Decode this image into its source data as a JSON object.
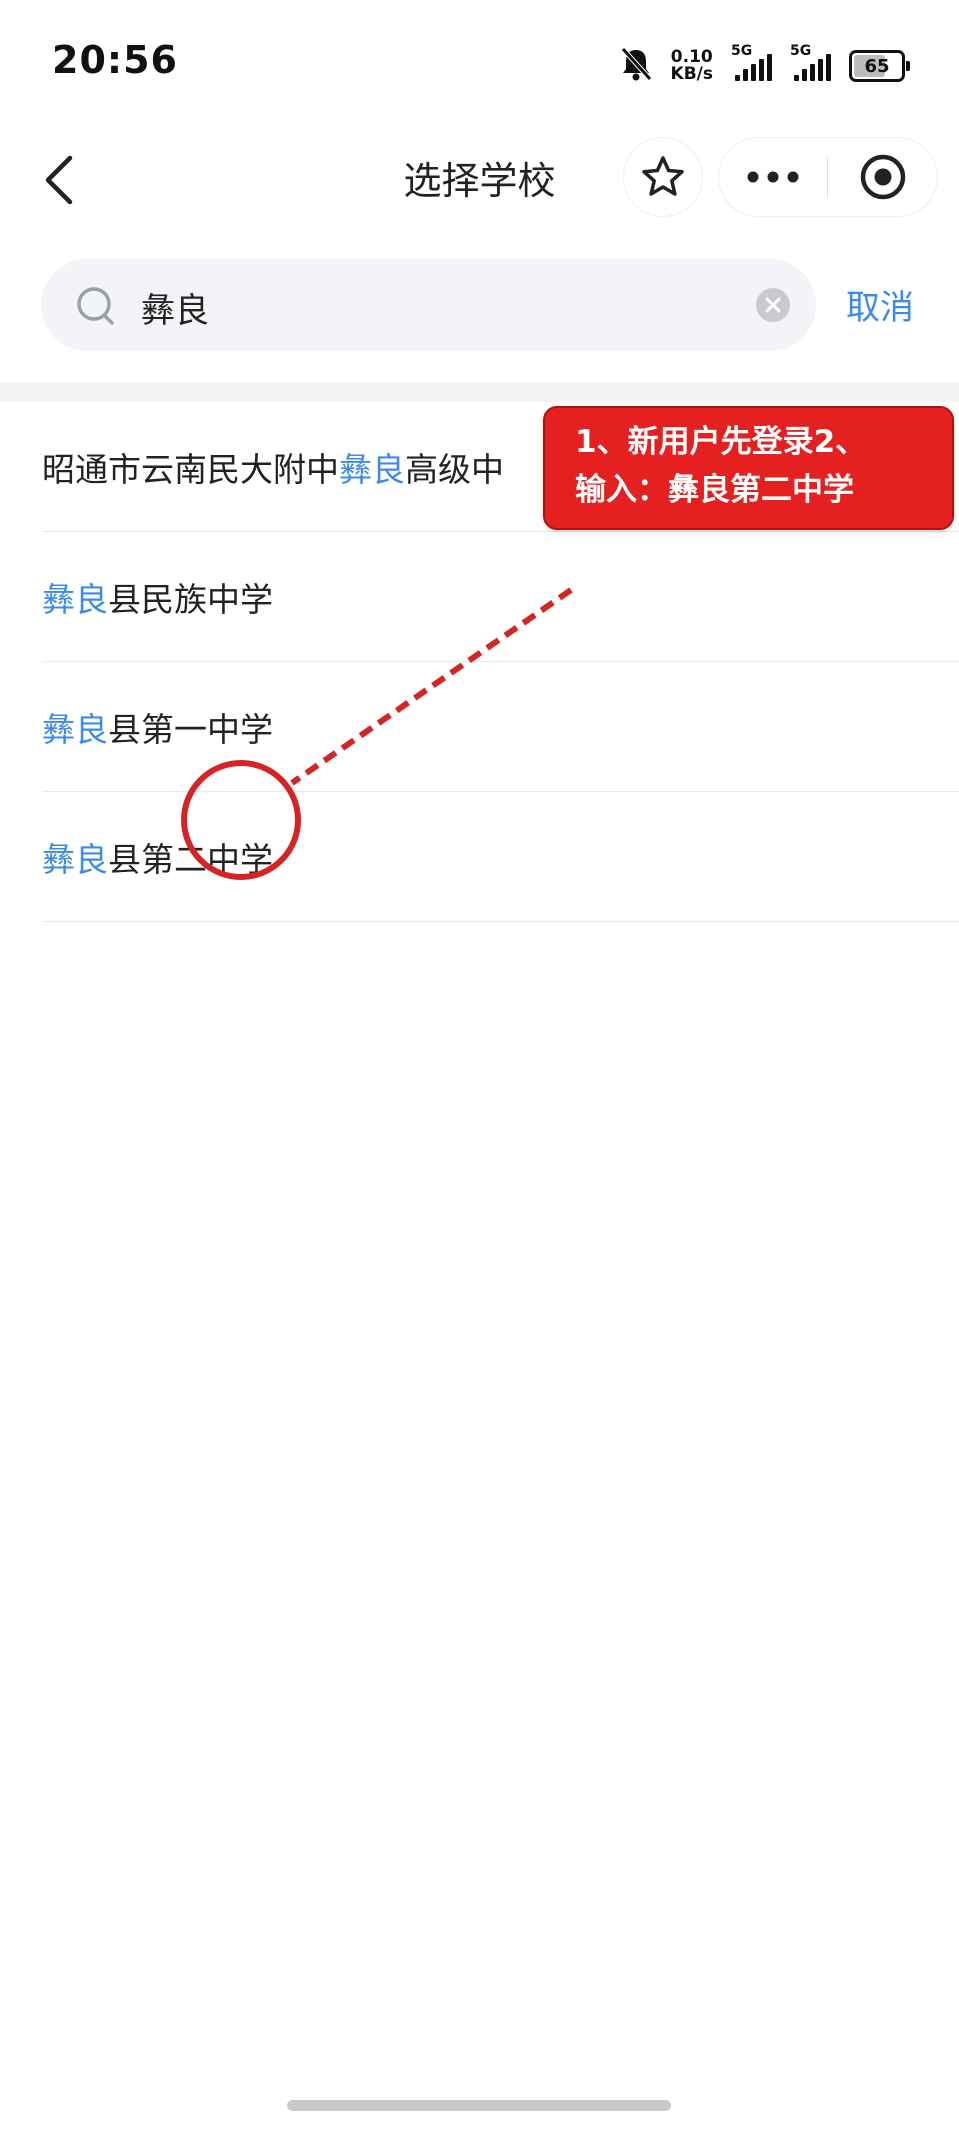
{
  "status_bar": {
    "time": "20:56",
    "net_speed_value": "0.10",
    "net_speed_unit": "KB/s",
    "sim1_label": "5G",
    "sim2_label": "5G",
    "battery": "65",
    "icons": [
      "bell-off-icon",
      "signal-icon",
      "battery-icon"
    ]
  },
  "nav": {
    "title": "选择学校",
    "icons": [
      "back-arrow-icon",
      "star-icon",
      "more-dots-icon",
      "target-close-icon"
    ]
  },
  "search": {
    "value": "彝良",
    "cancel_label": "取消",
    "icons": [
      "search-icon",
      "clear-icon"
    ]
  },
  "results": [
    {
      "pre": "昭通市云南民大附中",
      "hl": "彝良",
      "post": "高级中"
    },
    {
      "pre": "",
      "hl": "彝良",
      "post": "县民族中学"
    },
    {
      "pre": "",
      "hl": "彝良",
      "post": "县第一中学"
    },
    {
      "pre": "",
      "hl": "彝良",
      "post": "县第二中学"
    }
  ],
  "annotation": {
    "line1": "1、新用户先登录2、",
    "line2": "输入：彝良第二中学"
  },
  "colors": {
    "accent": "#3d8be8",
    "annotation_red": "#e52020",
    "search_bg": "#f2f4f7"
  }
}
